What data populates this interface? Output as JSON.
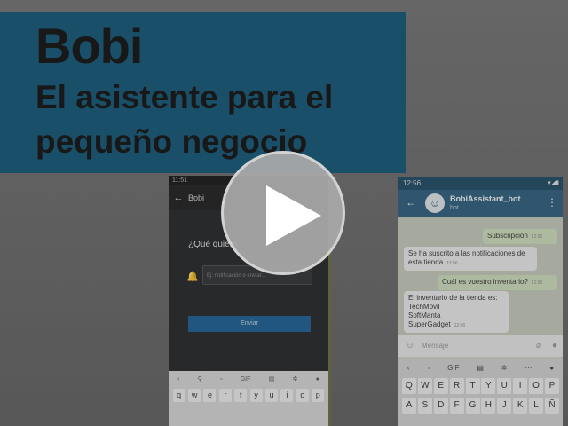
{
  "banner": {
    "brand": "Bobi",
    "tagline_line1": "El asistente para el",
    "tagline_line2": "pequeño negocio"
  },
  "phone_left": {
    "status_time": "11:51",
    "title": "Bobi",
    "question": "¿Qué quiere",
    "input_placeholder": "Ej: notificación o enviar...",
    "send_label": "Enviar",
    "keyboard_suggestions": [
      "GIF"
    ],
    "keyboard_row1": [
      "q",
      "w",
      "e",
      "r",
      "t",
      "y",
      "u",
      "i",
      "o",
      "p"
    ]
  },
  "phone_right": {
    "status_time": "12:56",
    "bot_name": "BobiAssistant_bot",
    "bot_sub": "bot",
    "messages": [
      {
        "text": "Subscripción",
        "time": "12:56",
        "dir": "out"
      },
      {
        "text": "Se ha suscrito a las notificaciones de esta tienda",
        "time": "12:56",
        "dir": "in"
      },
      {
        "text": "Cuál es vuestro inventario?",
        "time": "12:56",
        "dir": "out"
      },
      {
        "line1": "El inventario de la tienda es:",
        "line2": "TechMovil",
        "line3": "SoftManta",
        "line4": "SuperGadget",
        "time": "12:56",
        "dir": "in"
      }
    ],
    "input_placeholder": "Mensaje",
    "keyboard_suggestions": [
      "GIF"
    ],
    "keyboard_row1": [
      "Q",
      "W",
      "E",
      "R",
      "T",
      "Y",
      "U",
      "I",
      "O",
      "P"
    ],
    "keyboard_row2": [
      "A",
      "S",
      "D",
      "F",
      "G",
      "H",
      "J",
      "K",
      "L",
      "Ñ"
    ]
  },
  "icons": {
    "play": "play-icon",
    "back": "back-arrow-icon",
    "bell": "bell-icon",
    "emoji": "emoji-icon",
    "attach": "paperclip-icon",
    "mic": "mic-icon"
  }
}
